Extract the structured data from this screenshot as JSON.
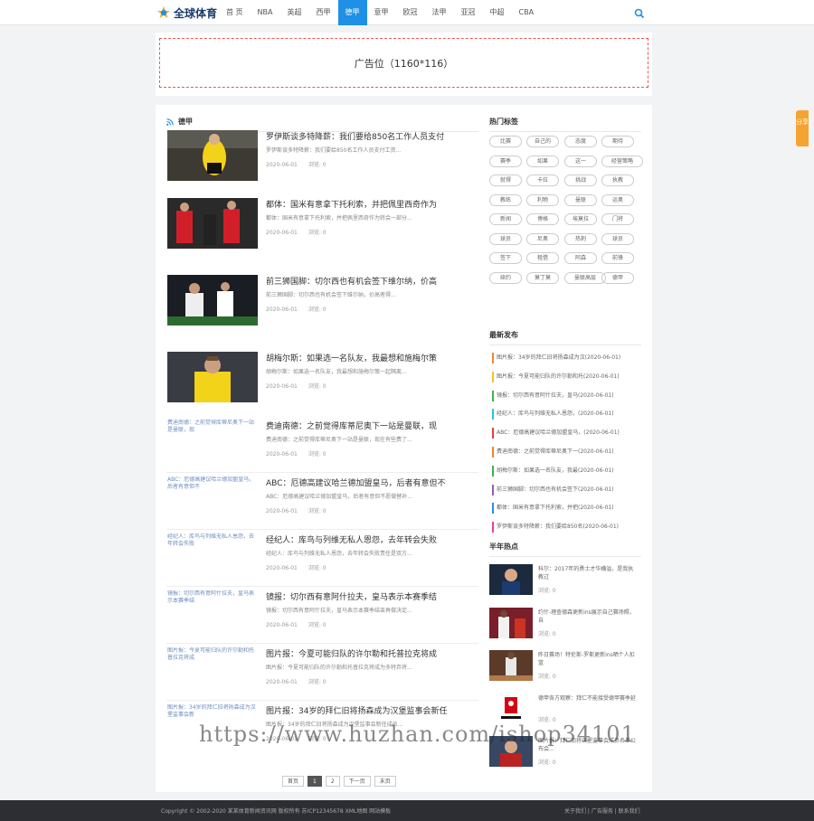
{
  "header": {
    "logo_text": "全球体育",
    "nav": [
      "首 页",
      "NBA",
      "英超",
      "西甲",
      "德甲",
      "意甲",
      "欧冠",
      "法甲",
      "亚冠",
      "中超",
      "CBA"
    ],
    "active_index": 4
  },
  "ad": {
    "label": "广告位（1160*116）"
  },
  "section": {
    "title": "德甲"
  },
  "articles": [
    {
      "title": "罗伊斯谈多特降薪：我们要给850名工作人员支付",
      "summary": "罗伊斯谈多特降薪：我们要给850名工作人员支付工资...",
      "date": "2020-06-01",
      "views": "浏览: 0",
      "thumb_alt": ""
    },
    {
      "title": "都体：国米有意拿下托利索，并把佩里西奇作为",
      "summary": "都体：国米有意拿下托利索，并把佩里西奇作为转会一部分...",
      "date": "2020-06-01",
      "views": "浏览: 0",
      "thumb_alt": ""
    },
    {
      "title": "前三狮国脚：切尔西也有机会签下维尔纳，价高",
      "summary": "前三狮国脚：切尔西也有机会签下维尔纳，价高者得...",
      "date": "2020-06-01",
      "views": "浏览: 0",
      "thumb_alt": ""
    },
    {
      "title": "胡梅尔斯：如果选一名队友，我最想和施梅尔策",
      "summary": "胡梅尔斯：如果选一名队友，我最想和施梅尔策一起隔离...",
      "date": "2020-06-01",
      "views": "浏览: 0",
      "thumb_alt": ""
    },
    {
      "title": "费迪南德：之前觉得库蒂尼奥下一站是曼联，现",
      "summary": "费迪南德：之前觉得库蒂尼奥下一站是曼联，现在有些费了...",
      "date": "2020-06-01",
      "views": "浏览: 0",
      "thumb_alt": "费迪南德：之前觉得库蒂尼奥下一站是曼联，现"
    },
    {
      "title": "ABC：厄德高建议哈兰德加盟皇马，后者有意但不",
      "summary": "ABC：厄德高建议哈兰德加盟皇马，后者有意但不愿做替补...",
      "date": "2020-06-01",
      "views": "浏览: 0",
      "thumb_alt": "ABC：厄德高建议哈兰德加盟皇马，后者有意但不"
    },
    {
      "title": "经纪人：库鸟与列维无私人恩怨，去年转会失败",
      "summary": "经纪人：库鸟与列维无私人恩怨，去年转会失败责任是双方...",
      "date": "2020-06-01",
      "views": "浏览: 0",
      "thumb_alt": "经纪人：库鸟与列维无私人恩怨，去年转会失败"
    },
    {
      "title": "镜报：切尔西有意阿什拉夫，皇马表示本赛季结",
      "summary": "镜报：切尔西有意阿什拉夫，皇马表示本赛季结束再做决定...",
      "date": "2020-06-01",
      "views": "浏览: 0",
      "thumb_alt": "镜报：切尔西有意阿什拉夫，皇马表示本赛季结"
    },
    {
      "title": "图片报：今夏可能归队的许尔勒和托普拉克将成",
      "summary": "图片报：今夏可能归队的许尔勒和托普拉克将成为多特弃将...",
      "date": "2020-06-01",
      "views": "浏览: 0",
      "thumb_alt": "图片报：今夏可能归队的许尔勒和托普拉克将成"
    },
    {
      "title": "图片报：34岁的拜仁旧将扬森成为汉堡监事会新任",
      "summary": "图片报：34岁的拜仁旧将扬森成为汉堡监事会新任成员...",
      "date": "2020-06-01",
      "views": "浏览: 0",
      "thumb_alt": "图片报：34岁的拜仁旧将扬森成为汉堡监事会新"
    }
  ],
  "pager": [
    "首页",
    "1",
    "2",
    "下一页",
    "末页"
  ],
  "hot_tags": {
    "title": "热门标签",
    "tags": [
      "比赛",
      "自己的",
      "态度",
      "期待",
      "赛季",
      "如果",
      "这一",
      "经营策略",
      "就得",
      "卡拉",
      "挑战",
      "执教",
      "教练",
      "利物",
      "曼联",
      "运奥",
      "新闻",
      "博格",
      "埃莫拉",
      "门将",
      "球员",
      "尼奥",
      "热刺",
      "球员",
      "签下",
      "租借",
      "阿森",
      "前锋",
      "续约",
      "莫丁莫",
      "曼联高层",
      "德甲"
    ]
  },
  "latest": {
    "title": "最新发布",
    "items": [
      {
        "text": "图片报：34岁的拜仁旧将扬森成为汉(2020-06-01)",
        "color": "#f0882b"
      },
      {
        "text": "图片报：今夏可能归队的许尔勒和托(2020-06-01)",
        "color": "#f2c230"
      },
      {
        "text": "镜报：切尔西有意阿什拉夫，皇马(2020-06-01)",
        "color": "#3cb44b"
      },
      {
        "text": "经纪人：库鸟与列维无私人恩怨，(2020-06-01)",
        "color": "#29c5d6"
      },
      {
        "text": "ABC：厄德高建议哈兰德加盟皇马，(2020-06-01)",
        "color": "#e0463a"
      },
      {
        "text": "费迪南德：之前觉得库蒂尼奥下一(2020-06-01)",
        "color": "#f0882b"
      },
      {
        "text": "胡梅尔斯：如果选一名队友，我最(2020-06-01)",
        "color": "#3cb44b"
      },
      {
        "text": "前三狮国脚：切尔西也有机会签下(2020-06-01)",
        "color": "#9b59b6"
      },
      {
        "text": "都体：国米有意拿下托利索，并把(2020-06-01)",
        "color": "#2b8ce6"
      },
      {
        "text": "罗伊斯谈多特降薪：我们要给850名(2020-06-01)",
        "color": "#e84393"
      }
    ]
  },
  "hot": {
    "title": "半年热点",
    "items": [
      {
        "title": "科尔：2017年的勇士才华横溢，是我执教过",
        "views": "浏览: 0"
      },
      {
        "title": "约什-理查德森更新ins展示自己赛场照，自",
        "views": "浏览: 0"
      },
      {
        "title": "昨日赛场！特伦斯-罗斯更新ins晒个人扣篮",
        "views": "浏览: 0"
      },
      {
        "title": "德甲各方观察：拜仁不能接受德甲赛季延",
        "views": "浏览: 0"
      },
      {
        "title": "图片报：拜仁旧将汉堡监事会成员名单公布会...",
        "views": "浏览: 0"
      }
    ]
  },
  "footer": {
    "copyright": "Copyright © 2002-2020 某某体育新闻资讯网 版权所有 苏ICP12345678 XML地图 网站模板",
    "links": "关于我们 | 广告服务 | 联系我们"
  },
  "share": {
    "label": "分享"
  },
  "watermark": {
    "text": "https://www.huzhan.com/ishop34101"
  }
}
